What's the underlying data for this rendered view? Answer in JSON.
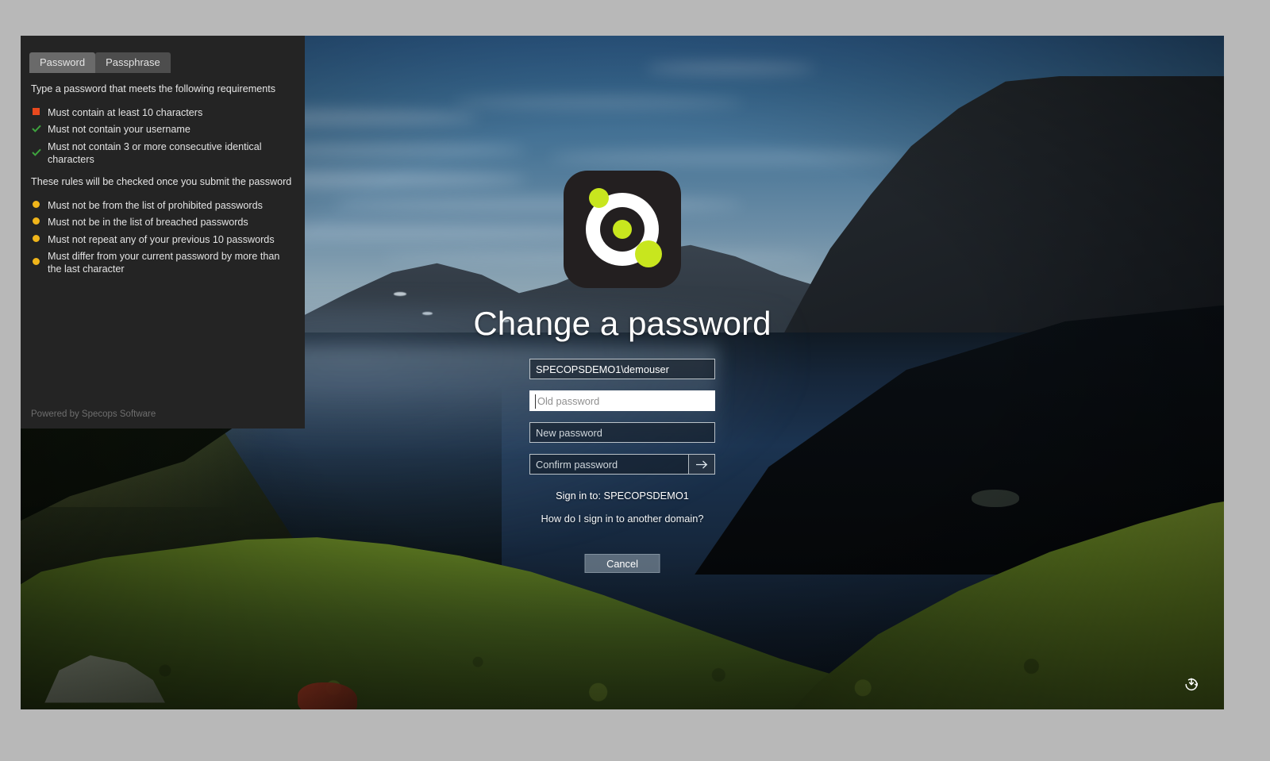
{
  "screen": {
    "title": "Change a password",
    "logo_icon": "specops-logo-icon"
  },
  "panel": {
    "tabs": [
      {
        "label": "Password",
        "selected": true
      },
      {
        "label": "Passphrase",
        "selected": false
      }
    ],
    "intro": "Type a password that meets the following requirements",
    "rules_immediate": [
      {
        "status": "fail",
        "text": "Must contain at least 10 characters"
      },
      {
        "status": "pass",
        "text": "Must not contain your username"
      },
      {
        "status": "pass",
        "text": "Must not contain 3 or more consecutive identical characters"
      }
    ],
    "note": "These rules will be checked once you submit the password",
    "rules_deferred": [
      {
        "status": "pending",
        "text": "Must not be from the list of prohibited passwords"
      },
      {
        "status": "pending",
        "text": "Must not be in the list of breached passwords"
      },
      {
        "status": "pending",
        "text": "Must not repeat any of your previous 10 passwords"
      },
      {
        "status": "pending",
        "text": "Must differ from your current password by more than the last character"
      }
    ],
    "footer": "Powered by Specops Software"
  },
  "form": {
    "username_value": "SPECOPSDEMO1\\demouser",
    "old_password_placeholder": "Old password",
    "new_password_placeholder": "New password",
    "confirm_password_placeholder": "Confirm password",
    "submit_icon": "arrow-right-icon",
    "sign_in_to": "Sign in to: SPECOPSDEMO1",
    "another_domain_link": "How do I sign in to another domain?",
    "cancel_label": "Cancel"
  },
  "chrome": {
    "power_icon": "power-icon"
  },
  "colors": {
    "fail": "#e8491e",
    "pass": "#3ea33e",
    "pending": "#f0b51a",
    "brand_green": "#c8e61e",
    "panel_bg": "#242424",
    "tab_selected": "#6a6a6a",
    "tab_unselected": "#4d4d4d"
  }
}
